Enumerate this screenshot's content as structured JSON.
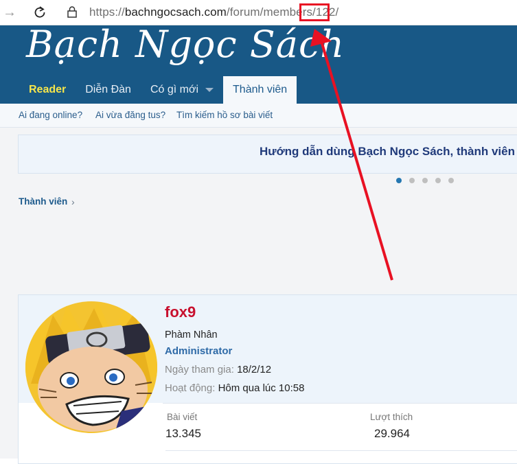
{
  "browser": {
    "url_prefix": "https://",
    "url_domain": "bachngocsach.com",
    "url_path": "/forum/members/",
    "url_highlight": "122/"
  },
  "site": {
    "logo_text": "Bạch Ngọc Sách",
    "nav": [
      {
        "label": "Reader"
      },
      {
        "label": "Diễn Đàn"
      },
      {
        "label": "Có gì mới"
      },
      {
        "label": "Thành viên"
      }
    ],
    "subnav": [
      {
        "label": "Ai đang online?"
      },
      {
        "label": "Ai vừa đăng tus?"
      },
      {
        "label": "Tìm kiếm hồ sơ bài viết"
      }
    ]
  },
  "notice": {
    "text": "Hướng dẫn dùng Bạch Ngọc Sách, thành viên"
  },
  "breadcrumb": {
    "label": "Thành viên"
  },
  "profile": {
    "username": "fox9",
    "title": "Phàm Nhân",
    "role": "Administrator",
    "joined_label": "Ngày tham gia:",
    "joined_value": "18/2/12",
    "activity_label": "Hoạt động:",
    "activity_value": "Hôm qua lúc 10:58",
    "stats": [
      {
        "label": "Bài viết",
        "value": "13.345"
      },
      {
        "label": "Lượt thích",
        "value": "29.964"
      }
    ]
  },
  "colors": {
    "header_bg": "#185886",
    "accent": "#2577b1",
    "username": "#c8102e",
    "annotation": "#e81123"
  }
}
